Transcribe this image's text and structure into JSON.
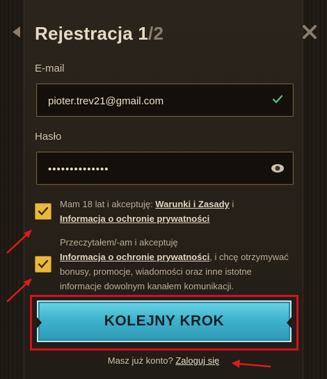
{
  "header": {
    "title_main": "Rejestracja 1",
    "title_slash": "/",
    "title_total": "2"
  },
  "email": {
    "label": "E-mail",
    "value": "pioter.trev21@gmail.com"
  },
  "password": {
    "label": "Hasło",
    "value": "••••••••••••••"
  },
  "consent1": {
    "text_before": "Mam 18 lat i akceptuję: ",
    "link1": "Warunki i Zasady",
    "text_middle": " i ",
    "link2": "Informacja o ochronie prywatności"
  },
  "consent2": {
    "text_before": "Przeczytałem/-am i akceptuję ",
    "link": "Informacja o ochronie prywatności",
    "text_after": ", i chcę otrzymywać bonusy, promocje, wiadomości oraz inne istotne informacje dowolnym kanałem komunikacji."
  },
  "next_button": {
    "label": "KOLEJNY KROK"
  },
  "footer": {
    "question": "Masz już konto? ",
    "login_link": "Zaloguj się"
  },
  "colors": {
    "accent_gold": "#e8b93b",
    "button_blue": "#3eb3cc",
    "highlight_red": "#d5101c",
    "success_green": "#5fc08a"
  }
}
